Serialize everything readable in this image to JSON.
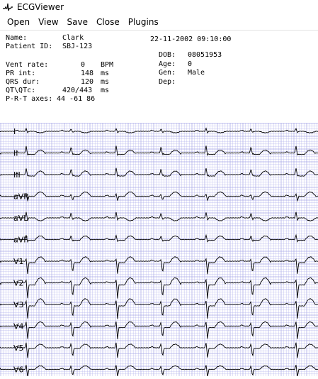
{
  "window": {
    "title": "ECGViewer",
    "icon": "ecg-waveform-icon"
  },
  "menu": [
    {
      "label": "Open"
    },
    {
      "label": "View"
    },
    {
      "label": "Save"
    },
    {
      "label": "Close"
    },
    {
      "label": "Plugins"
    }
  ],
  "patient": {
    "name_label": "Name:",
    "name_value": "Clark",
    "id_label": "Patient ID:",
    "id_value": "SBJ-123",
    "datetime": "22-11-2002 09:10:00",
    "dob_label": "DOB:",
    "dob_value": "08051953",
    "age_label": "Age:",
    "age_value": "0",
    "gen_label": "Gen:",
    "gen_value": "Male",
    "dep_label": "Dep:",
    "dep_value": ""
  },
  "measurements": {
    "vent_rate_label": "Vent rate:",
    "vent_rate_value": "0",
    "vent_rate_unit": "BPM",
    "pr_label": "PR int:",
    "pr_value": "148",
    "pr_unit": "ms",
    "qrs_label": "QRS dur:",
    "qrs_value": "120",
    "qrs_unit": "ms",
    "qt_label": "QT\\QTc:",
    "qt_value": "420/443",
    "qt_unit": "ms",
    "axes_label": "P-R-T axes:",
    "axes_value": "44 -61 86"
  },
  "ecg": {
    "grid_color": "#b8b8ee",
    "grid_major_color": "#a7a7e6",
    "trace_color": "#000000",
    "leads": [
      "I",
      "II",
      "III",
      "aVR",
      "aVL",
      "aVF",
      "V1",
      "V2",
      "V3",
      "V4",
      "V5",
      "V6"
    ]
  }
}
